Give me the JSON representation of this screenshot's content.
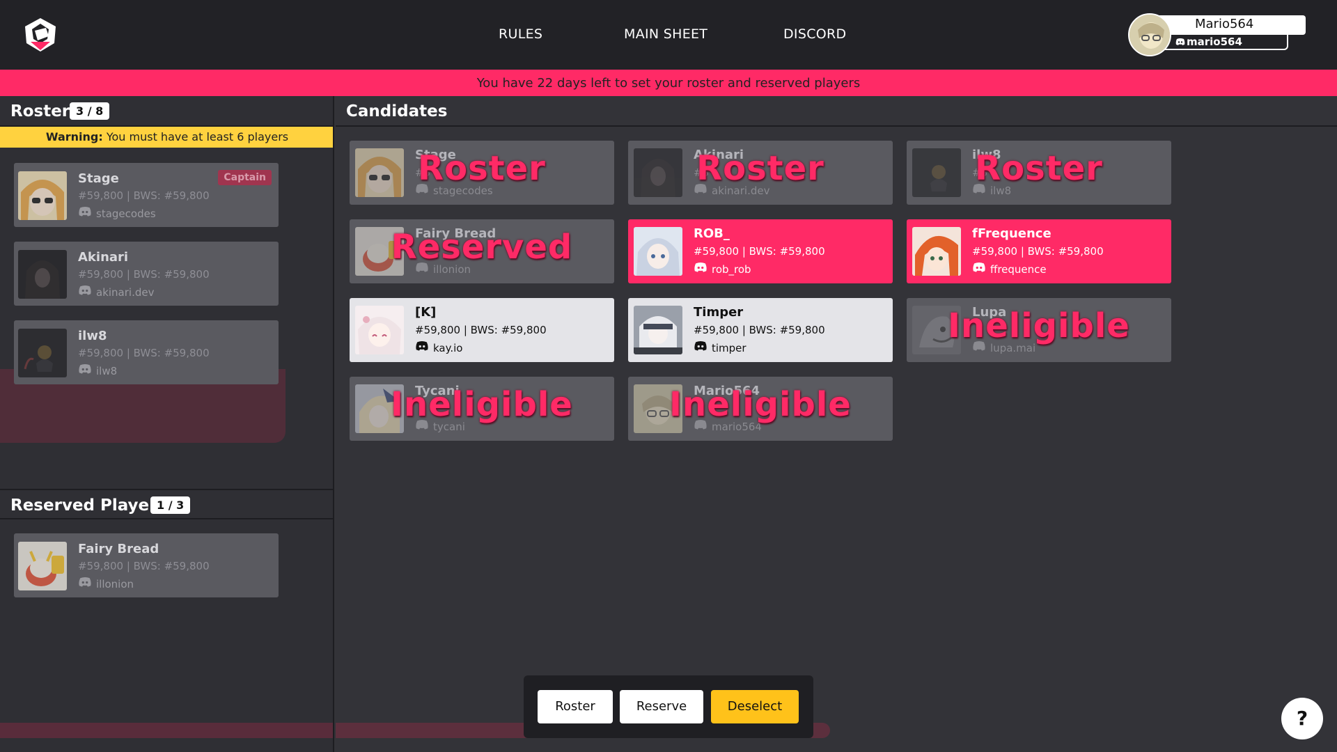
{
  "nav": {
    "items": [
      "RULES",
      "MAIN SHEET",
      "DISCORD"
    ]
  },
  "user": {
    "name": "Mario564",
    "discord": "mario564"
  },
  "banner": "You have 22 days left to set your roster and reserved players",
  "roster": {
    "title": "Roster",
    "count": "3 / 8",
    "warning_label": "Warning:",
    "warning_text": "You must have at least 6 players",
    "players": [
      {
        "name": "Stage",
        "rank": "#59,800 | BWS: #59,800",
        "discord": "stagecodes",
        "badge": "Captain"
      },
      {
        "name": "Akinari",
        "rank": "#59,800 | BWS: #59,800",
        "discord": "akinari.dev"
      },
      {
        "name": "ilw8",
        "rank": "#59,800 | BWS: #59,800",
        "discord": "ilw8"
      }
    ]
  },
  "reserved": {
    "title": "Reserved Players",
    "count": "1 / 3",
    "players": [
      {
        "name": "Fairy Bread",
        "rank": "#59,800 | BWS: #59,800",
        "discord": "illonion"
      }
    ]
  },
  "candidates": {
    "title": "Candidates",
    "cards": [
      {
        "name": "Stage",
        "rank": "#5",
        "discord": "stagecodes",
        "state": "dim",
        "overlay": "Roster"
      },
      {
        "name": "Akinari",
        "rank": "#5",
        "discord": "akinari.dev",
        "state": "dim",
        "overlay": "Roster"
      },
      {
        "name": "ilw8",
        "rank": "#5",
        "discord": "ilw8",
        "state": "dim",
        "overlay": "Roster"
      },
      {
        "name": "Fairy Bread",
        "rank": "",
        "discord": "illonion",
        "state": "dim",
        "overlay": "Reserved"
      },
      {
        "name": "ROB_",
        "rank": "#59,800 | BWS: #59,800",
        "discord": "rob_rob",
        "state": "pink",
        "overlay": ""
      },
      {
        "name": "fFrequence",
        "rank": "#59,800 | BWS: #59,800",
        "discord": "ffrequence",
        "state": "pink",
        "overlay": ""
      },
      {
        "name": "[K]",
        "rank": "#59,800 | BWS: #59,800",
        "discord": "kay.io",
        "state": "white",
        "overlay": ""
      },
      {
        "name": "Timper",
        "rank": "#59,800 | BWS: #59,800",
        "discord": "timper",
        "state": "white",
        "overlay": ""
      },
      {
        "name": "Lupa",
        "rank": "",
        "discord": "lupa.mai",
        "state": "dim",
        "overlay": "Ineligible"
      },
      {
        "name": "Tycani",
        "rank": "",
        "discord": "tycani",
        "state": "dim",
        "overlay": "Ineligible"
      },
      {
        "name": "Mario564",
        "rank": "",
        "discord": "mario564",
        "state": "dim",
        "overlay": "Ineligible"
      }
    ]
  },
  "actions": {
    "roster": "Roster",
    "reserve": "Reserve",
    "deselect": "Deselect"
  },
  "help": "?",
  "colors": {
    "accent": "#ff2a66",
    "warning": "#ffd23f",
    "deselect": "#ffc21a",
    "topbar": "#222226",
    "panel": "#333338",
    "card_dim": "#5a5a60",
    "card_selected": "#e4e4e8"
  },
  "icons": [
    "site-logo-icon",
    "discord-icon",
    "help-icon"
  ]
}
